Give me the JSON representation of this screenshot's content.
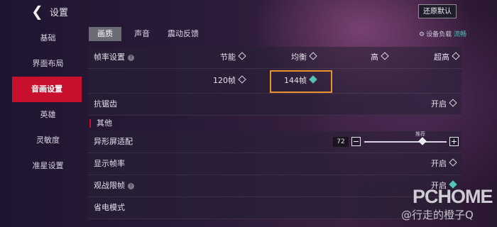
{
  "header": {
    "title": "设置",
    "reset_label": "还原默认"
  },
  "sidebar": {
    "items": [
      {
        "label": "基础"
      },
      {
        "label": "界面布局"
      },
      {
        "label": "音画设置",
        "active": true
      },
      {
        "label": "英雄"
      },
      {
        "label": "灵敏度"
      },
      {
        "label": "准星设置"
      }
    ]
  },
  "tabs": [
    {
      "label": "画质",
      "active": true
    },
    {
      "label": "声音"
    },
    {
      "label": "震动反馈"
    }
  ],
  "device_load": {
    "label": "设备负载",
    "value": "流畅"
  },
  "frame_rate": {
    "label": "帧率设置",
    "quality_options": [
      "节能",
      "均衡",
      "高",
      "超高"
    ],
    "fps_options": [
      "120帧",
      "144帧"
    ],
    "selected_fps": "144帧"
  },
  "antialias": {
    "label": "抗锯齿",
    "value": "开启"
  },
  "other_section": {
    "title": "其他"
  },
  "screen_adapt": {
    "label": "异形屏适配",
    "value": "72",
    "recommend_label": "推荐",
    "minus": "−",
    "plus": "+"
  },
  "show_fps": {
    "label": "显示帧率",
    "value": "开启"
  },
  "spectate_limit": {
    "label": "观战限帧",
    "value": "开启"
  },
  "power_save": {
    "label": "省电模式"
  },
  "watermark": {
    "brand": "PCHOME",
    "weibo": "@行走的橙子Q"
  },
  "colors": {
    "accent": "#c8102e",
    "highlight": "#e8912f",
    "check": "#54c2b8"
  }
}
